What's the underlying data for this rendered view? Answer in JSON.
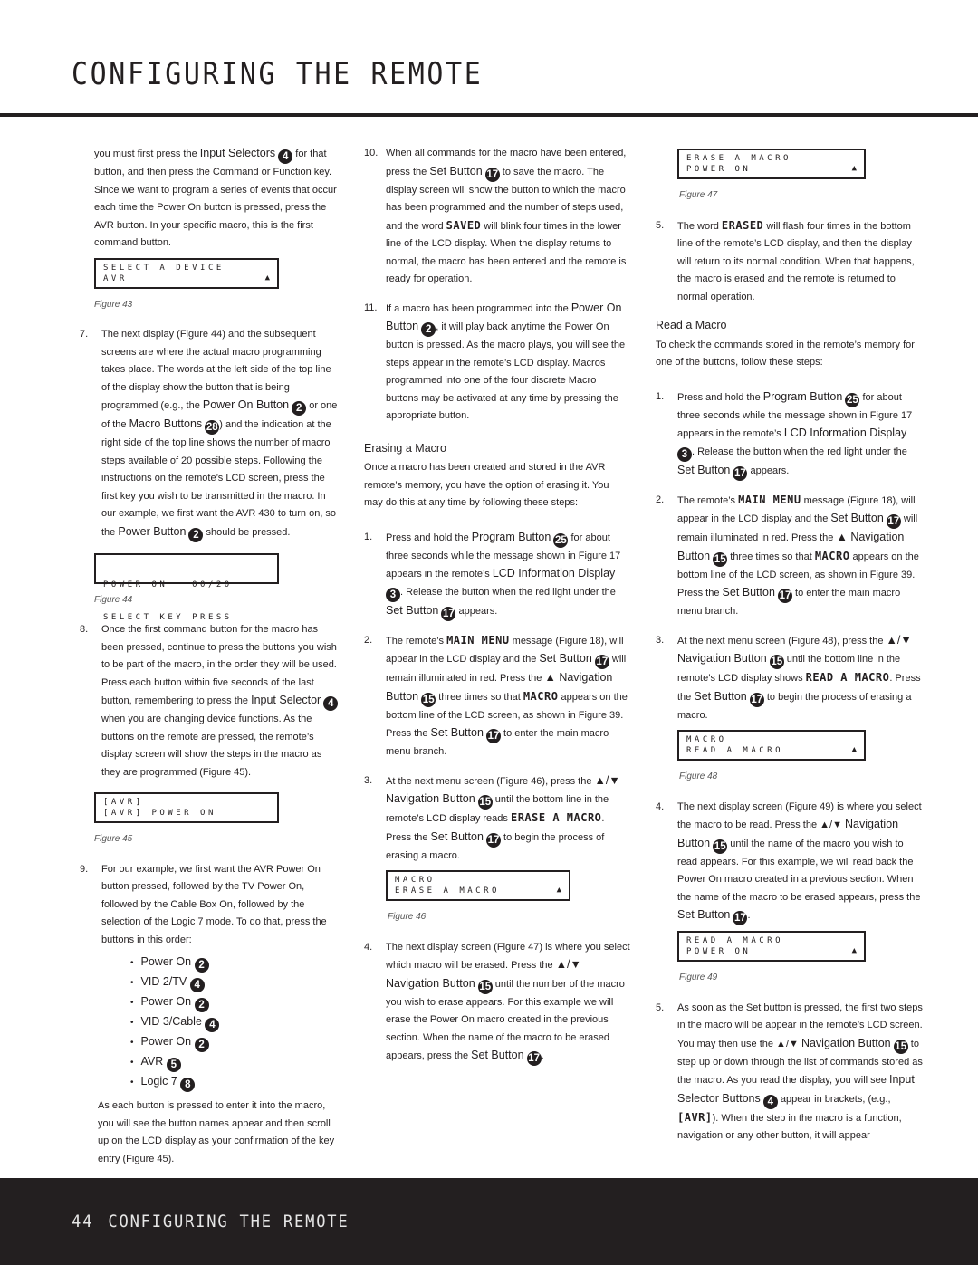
{
  "header": {
    "title": "CONFIGURING THE REMOTE"
  },
  "footer": {
    "page_number": "44",
    "title": "CONFIGURING THE REMOTE"
  },
  "column1": {
    "intro": {
      "a": "you must first press the ",
      "b": "Input Selectors",
      "badge": "4",
      "c": " for that button, and then press the Command or Function key. Since we want to program a series of events that occur each time the Power On button is pressed, press the AVR button. In your specific macro, this is the first command button."
    },
    "fig43": {
      "line1": "SELECT A DEVICE",
      "line2": "AVR",
      "arrow": "▲",
      "caption": "Figure 43"
    },
    "step7": {
      "num": "7.",
      "a": "The next display (Figure 44) and the subsequent screens are where the actual macro programming takes place. The words at the left side of the top line of the display show the button that is being programmed (e.g., the ",
      "b": "Power On Button",
      "badge1": "2",
      "c": " or one of the ",
      "d": "Macro Buttons",
      "badge2": "28",
      "e": ") and the indication at the right side of the top line shows the number of macro steps available of 20 possible steps. Following the instructions on the remote’s LCD screen, press the first key you wish to be transmitted in the macro. In our example, we first want the AVR 430 to turn on, so the ",
      "f": "Power Button",
      "badge3": "2",
      "g": " should be pressed."
    },
    "fig44": {
      "line1": "POWER ON   00/20",
      "line2": "SELECT KEY PRESS",
      "caption": "Figure 44"
    },
    "step8": {
      "num": "8.",
      "a": "Once the first command button for the macro has been pressed, continue to press the buttons you wish to be part of the macro, in the order they will be used. Press each button within five seconds of the last button, remembering to press the ",
      "b": "Input Selector",
      "badge": "4",
      "c": " when you are changing device functions. As the buttons on the remote are pressed, the remote’s display screen will show the steps in the macro as they are programmed (Figure 45)."
    },
    "fig45": {
      "line1": "[AVR]",
      "line2": "[AVR] POWER ON",
      "caption": "Figure 45"
    },
    "step9": {
      "num": "9.",
      "a": "For our example, we first want the AVR Power On button pressed, followed by the TV Power On, followed by the Cable Box On, followed by the selection of the Logic 7 mode. To do that, press the buttons in this order:"
    },
    "sequence": [
      {
        "label": "Power On",
        "badge": "2"
      },
      {
        "label": "VID 2/TV",
        "badge": "4"
      },
      {
        "label": "Power On",
        "badge": "2"
      },
      {
        "label": "VID 3/Cable",
        "badge": "4"
      },
      {
        "label": "Power On",
        "badge": "2"
      },
      {
        "label": "AVR",
        "badge": "5"
      },
      {
        "label": "Logic 7",
        "badge": "8"
      }
    ],
    "after": "As each button is pressed to enter it into the macro, you will see the button names appear and then scroll up on the LCD display as your confirmation of the key entry (Figure 45)."
  },
  "column2": {
    "step10": {
      "num": "10.",
      "a": "When all commands for the macro have been entered, press the ",
      "b": "Set Button",
      "badge": "17",
      "c": " to save the macro. The display screen will show the button to which the macro has been programmed and the number of steps used, and the word ",
      "lcd": "SAVED",
      "d": " will blink four times in the lower line of the LCD display. When the display returns to normal, the macro has been entered and the remote is ready for operation."
    },
    "step11": {
      "num": "11.",
      "a": "If a macro has been programmed into the ",
      "b": "Power On Button",
      "badge": "2",
      "c": ", it will play back anytime the Power On button is pressed. As the macro plays, you will see the steps appear in the remote’s LCD display. Macros programmed into one of the four discrete Macro buttons may be activated at any time by pressing the appropriate button."
    },
    "erasing_heading": "Erasing a Macro",
    "erasing_intro": "Once a macro has been created and stored in the AVR remote’s memory, you have the option of erasing it. You may do this at any time by following these steps:",
    "e1": {
      "num": "1.",
      "a": "Press and hold the ",
      "b": "Program Button",
      "badge1": "25",
      "c": " for about three seconds while the message shown in Figure 17 appears in the remote’s ",
      "d": "LCD Information Display",
      "badge2": "3",
      "e": ". Release the button when the red light under the ",
      "f": "Set Button",
      "badge3": "17",
      "g": " appears."
    },
    "e2": {
      "num": "2.",
      "a": "The remote’s ",
      "lcd1": "MAIN MENU",
      "b": " message (Figure 18), will appear in the LCD display and the ",
      "c": "Set Button",
      "badge1": "17",
      "d": " will remain illuminated in red. Press the ",
      "e": "▲ Navigation Button",
      "badge2": "15",
      "f": " three times so that ",
      "lcd2": "MACRO",
      "g": " appears on the bottom line of the LCD screen, as shown in Figure 39. Press the ",
      "h": "Set Button",
      "badge3": "17",
      "i": " to enter the main macro menu branch."
    },
    "e3": {
      "num": "3.",
      "a": "At the next menu screen (Figure 46), press the ",
      "b": "▲/▼ Navigation Button",
      "badge1": "15",
      "c": " until the bottom line in the remote’s LCD display reads ",
      "lcd": "ERASE A MACRO",
      "d": ". Press the ",
      "e": "Set Button",
      "badge2": "17",
      "f": " to begin the process of erasing a macro."
    },
    "fig46": {
      "line1": "MACRO",
      "line2": "ERASE A MACRO",
      "arrow": "▲",
      "caption": "Figure 46"
    },
    "e4": {
      "num": "4.",
      "a": "The next display screen (Figure 47) is where you select which macro will be erased. Press the ",
      "b": "▲/▼ Navigation Button",
      "badge1": "15",
      "c": " until the number of the macro you wish to erase appears. For this example we will erase the Power On macro created in the previous section. When the name of the macro to be erased appears, press the ",
      "d": "Set Button",
      "badge2": "17",
      "e": "."
    }
  },
  "column3": {
    "fig47": {
      "line1": "ERASE A MACRO",
      "line2": "POWER ON",
      "arrow": "▲",
      "caption": "Figure 47"
    },
    "e5": {
      "num": "5.",
      "a": "The word ",
      "lcd": "ERASED",
      "b": " will flash four times in the bottom line of the remote’s LCD display, and then the display will return to its normal condition. When that happens, the macro is erased and the remote is returned to normal operation."
    },
    "read_heading": "Read a Macro",
    "read_intro": "To check the commands stored in the remote’s memory for one of the buttons, follow these steps:",
    "r1": {
      "num": "1.",
      "a": "Press and hold the ",
      "b": "Program Button",
      "badge1": "25",
      "c": " for about three seconds while the message shown in Figure 17 appears in the remote’s ",
      "d": "LCD Information Display",
      "badge2": "3",
      "e": ". Release the button when the red light under the ",
      "f": "Set Button",
      "badge3": "17",
      "g": " appears."
    },
    "r2": {
      "num": "2.",
      "a": "The remote’s ",
      "lcd1": "MAIN MENU",
      "b": " message (Figure 18), will appear in the LCD display and the ",
      "c": "Set Button",
      "badge1": "17",
      "d": " will remain illuminated in red. Press the ",
      "e": "▲ Navigation Button",
      "badge2": "15",
      "f": " three times so that ",
      "lcd2": "MACRO",
      "g": " appears on the bottom line of the LCD screen, as shown in Figure 39. Press the ",
      "h": "Set Button",
      "badge3": "17",
      "i": " to enter the main macro menu branch."
    },
    "r3": {
      "num": "3.",
      "a": "At the next menu screen (Figure 48), press the ",
      "b": "▲/▼ Navigation Button",
      "badge1": "15",
      "c": " until the bottom line in the remote’s LCD display shows ",
      "lcd": "READ A MACRO",
      "d": ". Press the ",
      "e": "Set Button",
      "badge2": "17",
      "f": " to begin the process of erasing a macro."
    },
    "fig48": {
      "line1": "MACRO",
      "line2": "READ A MACRO",
      "arrow": "▲",
      "caption": "Figure 48"
    },
    "r4": {
      "num": "4.",
      "a": "The next display screen (Figure 49) is where you select the macro to be read. Press the ▲/▼ ",
      "b": "Navigation Button",
      "badge1": "15",
      "c": " until the name of the macro you wish to read appears. For this example, we will read back the Power On macro created in a previous section. When the name of the macro to be erased appears, press the ",
      "d": "Set Button",
      "badge2": "17",
      "e": "."
    },
    "fig49": {
      "line1": "READ A MACRO",
      "line2": "POWER ON",
      "arrow": "▲",
      "caption": "Figure 49"
    },
    "r5": {
      "num": "5.",
      "a": "As soon as the Set button is pressed, the first two steps in the macro will be appear in the remote’s LCD screen. You may then use the ▲/▼ ",
      "b": "Navigation Button",
      "badge1": "15",
      "c": " to step up or down through the list of commands stored as the macro. As you read the display, you will see ",
      "d": "Input Selector Buttons",
      "badge2": "4",
      "e": " appear in brackets, (e.g., ",
      "lcd": "[AVR]",
      "f": "). When the step in the macro is a function, navigation or any other button, it will appear"
    }
  }
}
